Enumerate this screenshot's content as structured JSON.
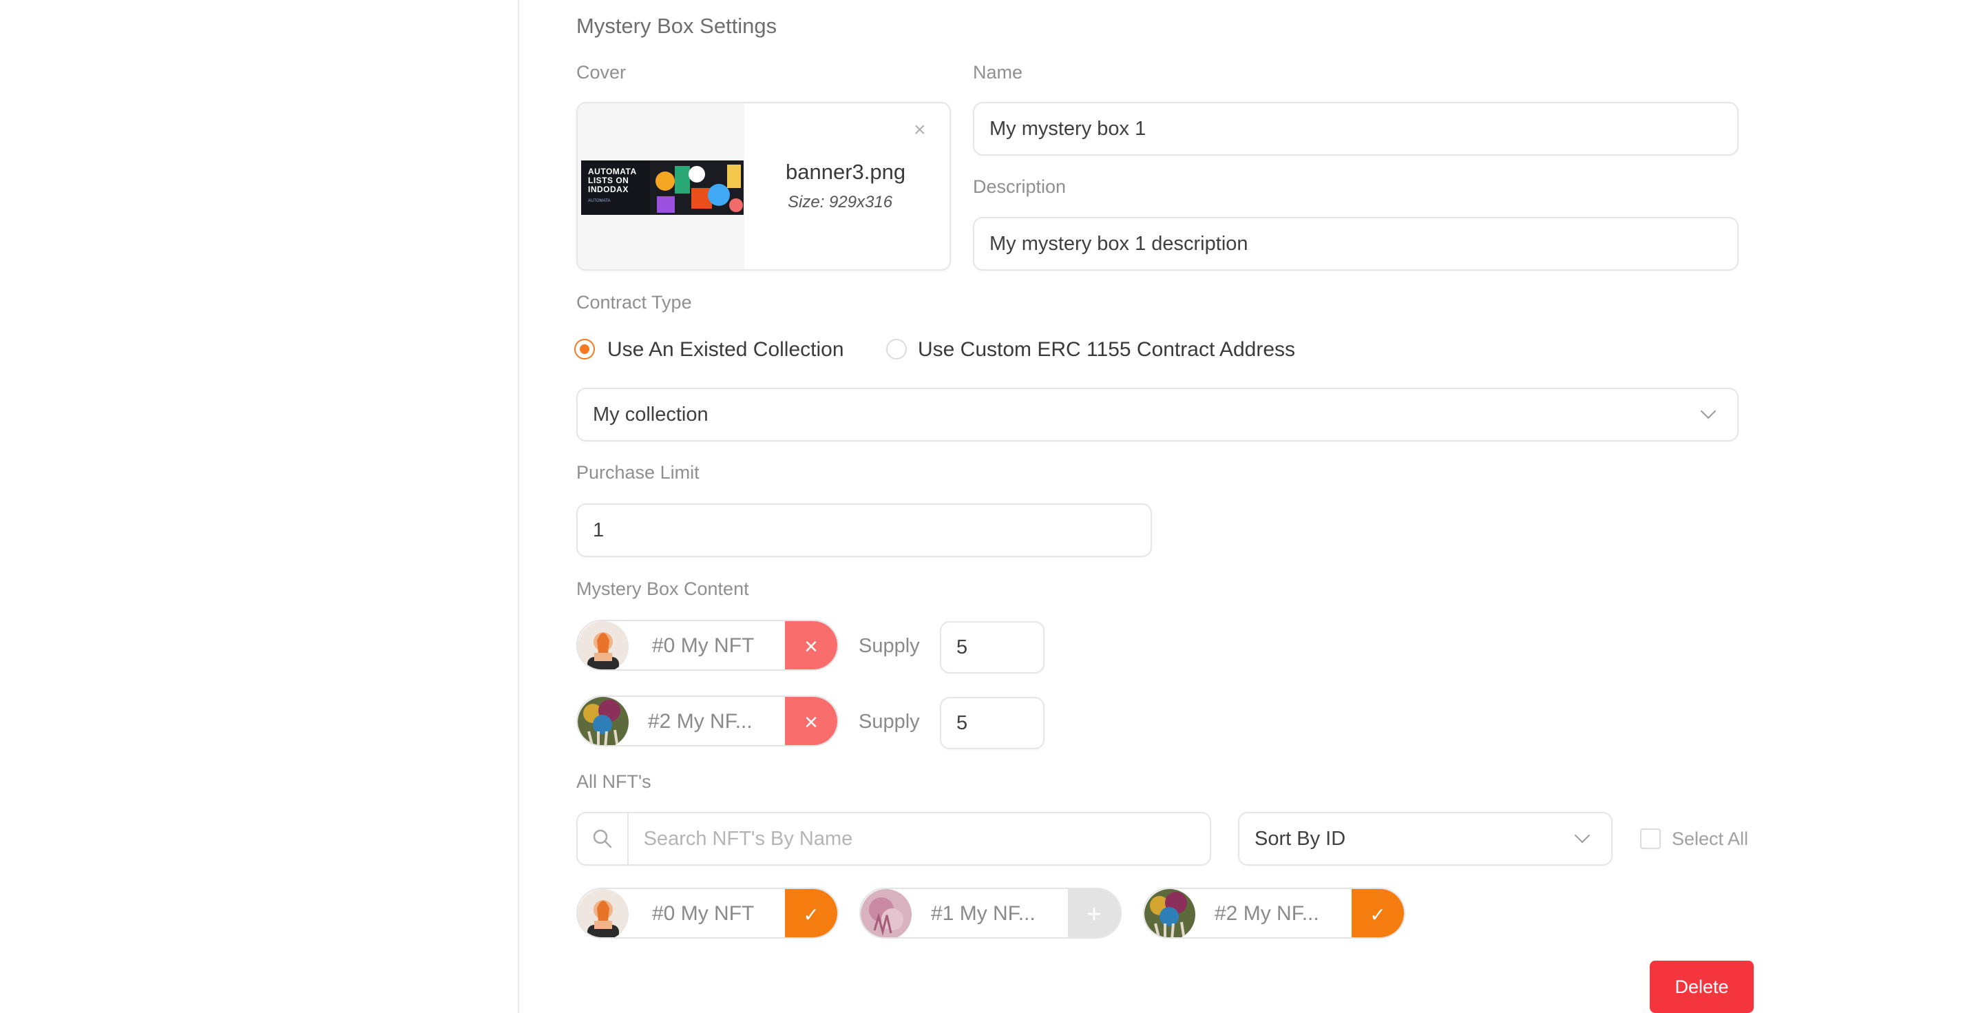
{
  "section_title": "Mystery Box Settings",
  "cover": {
    "label": "Cover",
    "file_name": "banner3.png",
    "file_size": "Size: 929x316",
    "thumbnail_text": "AUTOMATA LISTS ON INDODAX",
    "thumbnail_sub": "AUTOMATA",
    "close_icon": "×"
  },
  "name": {
    "label": "Name",
    "value": "My mystery box 1"
  },
  "description": {
    "label": "Description",
    "value": "My mystery box 1 description"
  },
  "contract_type": {
    "label": "Contract Type",
    "options": [
      {
        "label": "Use An Existed Collection",
        "selected": true
      },
      {
        "label": "Use Custom ERC 1155 Contract Address",
        "selected": false
      }
    ]
  },
  "collection_select": {
    "value": "My collection"
  },
  "purchase_limit": {
    "label": "Purchase Limit",
    "value": "1"
  },
  "mystery_box_content": {
    "label": "Mystery Box Content",
    "supply_label": "Supply",
    "items": [
      {
        "name": "#0 My NFT",
        "supply": "5",
        "action_icon": "×"
      },
      {
        "name": "#2 My NF...",
        "supply": "5",
        "action_icon": "×"
      }
    ]
  },
  "all_nfts": {
    "label": "All NFT's",
    "search_placeholder": "Search NFT's By Name",
    "sort_value": "Sort By ID",
    "select_all_label": "Select All",
    "items": [
      {
        "name": "#0 My NFT",
        "state": "checked",
        "action_icon": "✓"
      },
      {
        "name": "#1 My NF...",
        "state": "add",
        "action_icon": "+"
      },
      {
        "name": "#2 My NF...",
        "state": "checked",
        "action_icon": "✓"
      }
    ]
  },
  "delete_button": "Delete",
  "colors": {
    "accent": "#f57c0f",
    "remove": "#f96d6d",
    "danger": "#f4353e"
  }
}
